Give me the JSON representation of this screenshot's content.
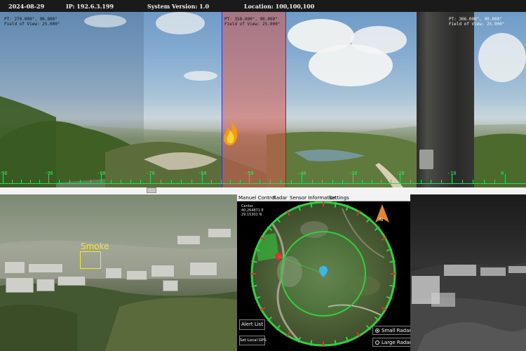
{
  "status_bar": {
    "date": "2024-08-29",
    "ip": "IP: 192.6.3.199",
    "version": "System Version: 1.0",
    "location": "Location: 100,100,100"
  },
  "panorama": {
    "left_camera": {
      "line1": "PT: 270.000°, 90.000°",
      "line2": "Field of View: 25.000°"
    },
    "center_camera": {
      "line1": "PT: 358.000°, 90.000°",
      "line2": "Field of View: 25.000°"
    },
    "right_camera": {
      "line1": "PT: 306.000°, 90.000°",
      "line2": "Field of View: 25.000°"
    },
    "scale_labels": [
      "-90",
      "-90",
      "-80",
      "-70",
      "-60",
      "-50",
      "-40",
      "-30",
      "-20",
      "-10",
      "0"
    ],
    "sector_color": "#d65a50",
    "sector_border_color": "#2d3bb8",
    "scale_color": "#26f060"
  },
  "left_camera": {
    "detection_label": "Smoke",
    "detection_color": "#f6e63a"
  },
  "radar": {
    "menu": [
      "Manuel Control",
      "Radar",
      "Sensor Information",
      "Settings"
    ],
    "center_title": "Center",
    "center_lat": "40.264871 E",
    "center_lon": "29.15301 N",
    "compass_letter": "N",
    "buttons": {
      "alert_list": "Alert List",
      "set_local_gps": "Set Local GPS"
    },
    "radio": {
      "small": "Small Radar",
      "large": "Large Radar",
      "selected": "small"
    },
    "ring_color": "#2fd13e",
    "target_color": "#e63030",
    "marker_color": "#39b8f0"
  }
}
